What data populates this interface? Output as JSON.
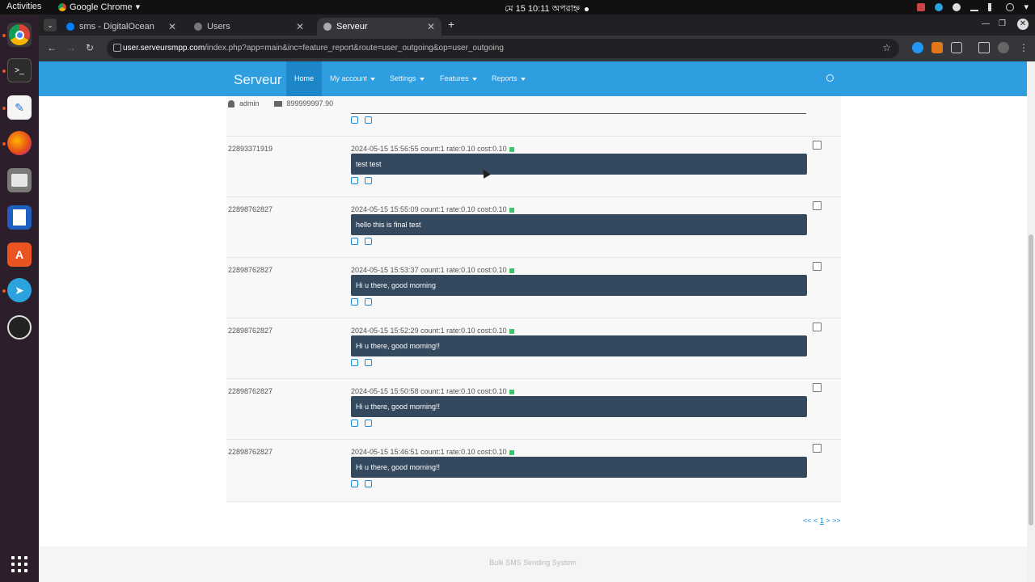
{
  "topbar": {
    "activities": "Activities",
    "app_name": "Google Chrome",
    "clock": "মে 15  10:11 অপরাহ্ন"
  },
  "browser": {
    "tabs": [
      {
        "title": "sms - DigitalOcean",
        "active": false
      },
      {
        "title": "Users",
        "active": false
      },
      {
        "title": "Serveur",
        "active": true
      }
    ],
    "url_domain": "user.serveursmpp.com",
    "url_path": "/index.php?app=main&inc=feature_report&route=user_outgoing&op=user_outgoing"
  },
  "navbar": {
    "brand": "Serveur",
    "items": [
      {
        "label": "Home",
        "active": true
      },
      {
        "label": "My account",
        "dropdown": true
      },
      {
        "label": "Settings",
        "dropdown": true
      },
      {
        "label": "Features",
        "dropdown": true
      },
      {
        "label": "Reports",
        "dropdown": true
      }
    ]
  },
  "user": {
    "name": "admin",
    "credit": "899999997.90"
  },
  "messages": [
    {
      "to": "22893371919",
      "meta": "2024-05-15 15:56:55 count:1 rate:0.10 cost:0.10",
      "text": "test test"
    },
    {
      "to": "22898762827",
      "meta": "2024-05-15 15:55:09 count:1 rate:0.10 cost:0.10",
      "text": "hello this is final test"
    },
    {
      "to": "22898762827",
      "meta": "2024-05-15 15:53:37 count:1 rate:0.10 cost:0.10",
      "text": "Hi u there, good morning"
    },
    {
      "to": "22898762827",
      "meta": "2024-05-15 15:52:29 count:1 rate:0.10 cost:0.10",
      "text": "Hi u there, good morning!!"
    },
    {
      "to": "22898762827",
      "meta": "2024-05-15 15:50:58 count:1 rate:0.10 cost:0.10",
      "text": "Hi u there, good morning!!"
    },
    {
      "to": "22898762827",
      "meta": "2024-05-15 15:46:51 count:1 rate:0.10 cost:0.10",
      "text": "Hi u there, good morning!!"
    }
  ],
  "pager": {
    "first": "<<",
    "prev": "<",
    "current": "1",
    "next": ">",
    "last": ">>"
  },
  "footer": "Bulk SMS Sending System",
  "colors": {
    "navbar": "#2f9ee0",
    "bubble": "#34495e",
    "status_ok": "#3ec36b"
  }
}
